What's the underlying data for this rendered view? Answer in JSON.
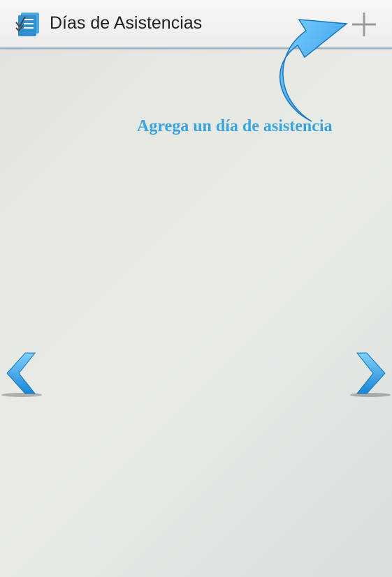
{
  "action_bar": {
    "title": "Días de Asistencias",
    "app_icon": "checklist-notebook-icon",
    "add_icon": "plus-icon"
  },
  "hint": {
    "text": "Agrega un día de asistencia",
    "arrow_icon": "curved-arrow-icon"
  },
  "navigation": {
    "prev_icon": "chevron-left-icon",
    "next_icon": "chevron-right-icon"
  },
  "colors": {
    "accent": "#3aa3dd",
    "title": "#222222",
    "action_bar_border": "#8fb3cf",
    "background": "#e6e9e2"
  }
}
